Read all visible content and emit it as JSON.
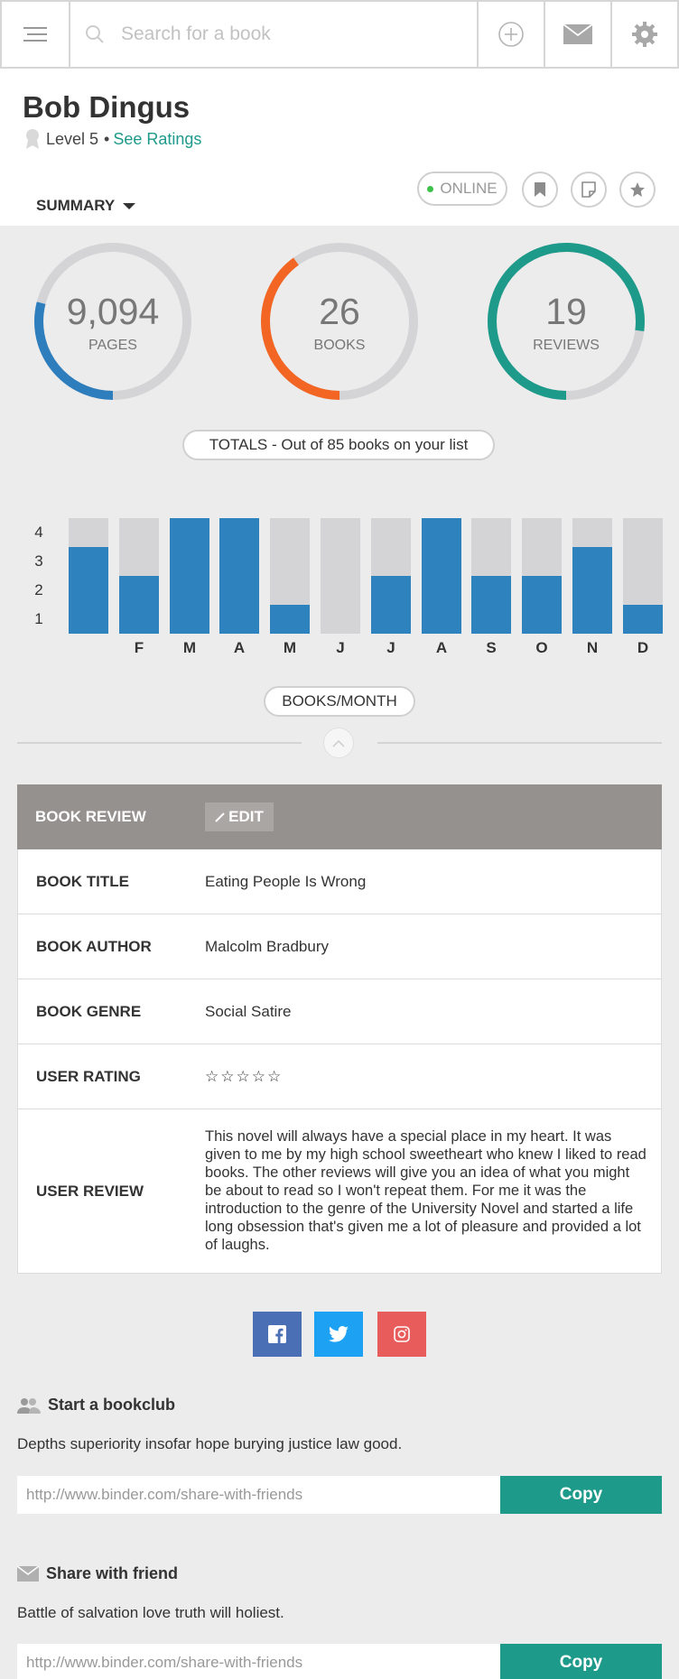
{
  "topbar": {
    "search_placeholder": "Search for a book",
    "icons": [
      "hamburger-menu-icon",
      "search-icon",
      "plus-circle-icon",
      "envelope-icon",
      "gear-icon"
    ]
  },
  "profile": {
    "name": "Bob Dingus",
    "level": "Level 5",
    "bullet": "•",
    "see_ratings": "See Ratings",
    "summary_label": "SUMMARY",
    "status": "ONLINE"
  },
  "stats": {
    "pages": {
      "value": "9,094",
      "label": "PAGES",
      "fraction": 0.29,
      "color": "#2e7dbc"
    },
    "books": {
      "value": "26",
      "label": "BOOKS",
      "fraction": 0.4,
      "color": "#f26522"
    },
    "reviews": {
      "value": "19",
      "label": "REVIEWS",
      "fraction": 0.77,
      "color": "#1d9a8a"
    },
    "totals_label": "TOTALS - Out of 85 books on your list"
  },
  "chart_data": {
    "type": "bar",
    "categories": [
      "",
      "F",
      "M",
      "A",
      "M",
      "J",
      "J",
      "A",
      "S",
      "O",
      "N",
      "D"
    ],
    "values": [
      3,
      2,
      4,
      4,
      1,
      0,
      2,
      4,
      2,
      2,
      3,
      1
    ],
    "ylim": [
      0,
      4
    ],
    "yticks": [
      "4",
      "3",
      "2",
      "1"
    ],
    "label": "BOOKS/MONTH"
  },
  "review": {
    "header": "BOOK REVIEW",
    "edit_label": "EDIT",
    "rows": [
      {
        "key": "BOOK TITLE",
        "value": "Eating People Is Wrong"
      },
      {
        "key": "BOOK AUTHOR",
        "value": "Malcolm Bradbury"
      },
      {
        "key": "BOOK GENRE",
        "value": "Social Satire"
      },
      {
        "key": "USER RATING",
        "value": "☆☆☆☆☆"
      },
      {
        "key": "USER REVIEW",
        "value": "This novel will always have a special place in my heart. It was given to me by my high school sweetheart who knew I liked to read books. The other reviews will give you an idea of what you might be about to read so I won't repeat them. For me it was the introduction to the genre of the University Novel and started a life long obsession that's given me a lot of pleasure and provided a lot of laughs."
      }
    ]
  },
  "social": {
    "facebook_color": "#4a6fb5",
    "twitter_color": "#1da1f2",
    "instagram_color": "#e85c5c"
  },
  "bookclub": {
    "title": "Start a bookclub",
    "description": "Depths superiority insofar hope burying justice law good.",
    "link": "http://www.binder.com/share-with-friends",
    "copy_label": "Copy"
  },
  "friend": {
    "title": "Share with friend",
    "description": "Battle of salvation love truth will holiest.",
    "link": "http://www.binder.com/share-with-friends",
    "copy_label": "Copy"
  }
}
